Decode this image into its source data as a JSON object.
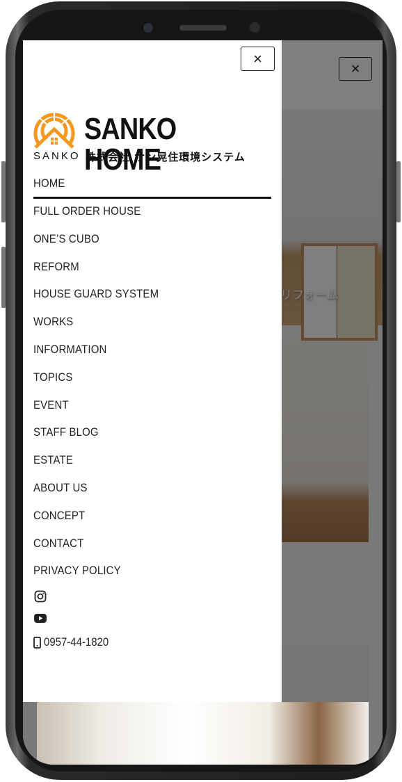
{
  "background": {
    "close_label": "×",
    "hero_label": "リフォーム"
  },
  "menu": {
    "close_label": "×",
    "logo": {
      "title": "SANKO HOME",
      "mark_text": "SANKO",
      "subtitle": "株式会社 サン晃住環境システム",
      "brand_color": "#f39a1e"
    },
    "items": [
      {
        "label": "HOME",
        "active": true
      },
      {
        "label": "FULL ORDER HOUSE"
      },
      {
        "label": "ONE’S CUBO"
      },
      {
        "label": "REFORM"
      },
      {
        "label": "HOUSE GUARD SYSTEM"
      },
      {
        "label": "WORKS"
      },
      {
        "label": "INFORMATION"
      },
      {
        "label": "TOPICS"
      },
      {
        "label": "EVENT"
      },
      {
        "label": "STAFF BLOG"
      },
      {
        "label": "ESTATE"
      },
      {
        "label": "ABOUT US"
      },
      {
        "label": "CONCEPT"
      },
      {
        "label": "CONTACT"
      },
      {
        "label": "PRIVACY POLICY"
      }
    ],
    "social": [
      "instagram-icon",
      "youtube-icon"
    ],
    "phone": "0957-44-1820"
  }
}
